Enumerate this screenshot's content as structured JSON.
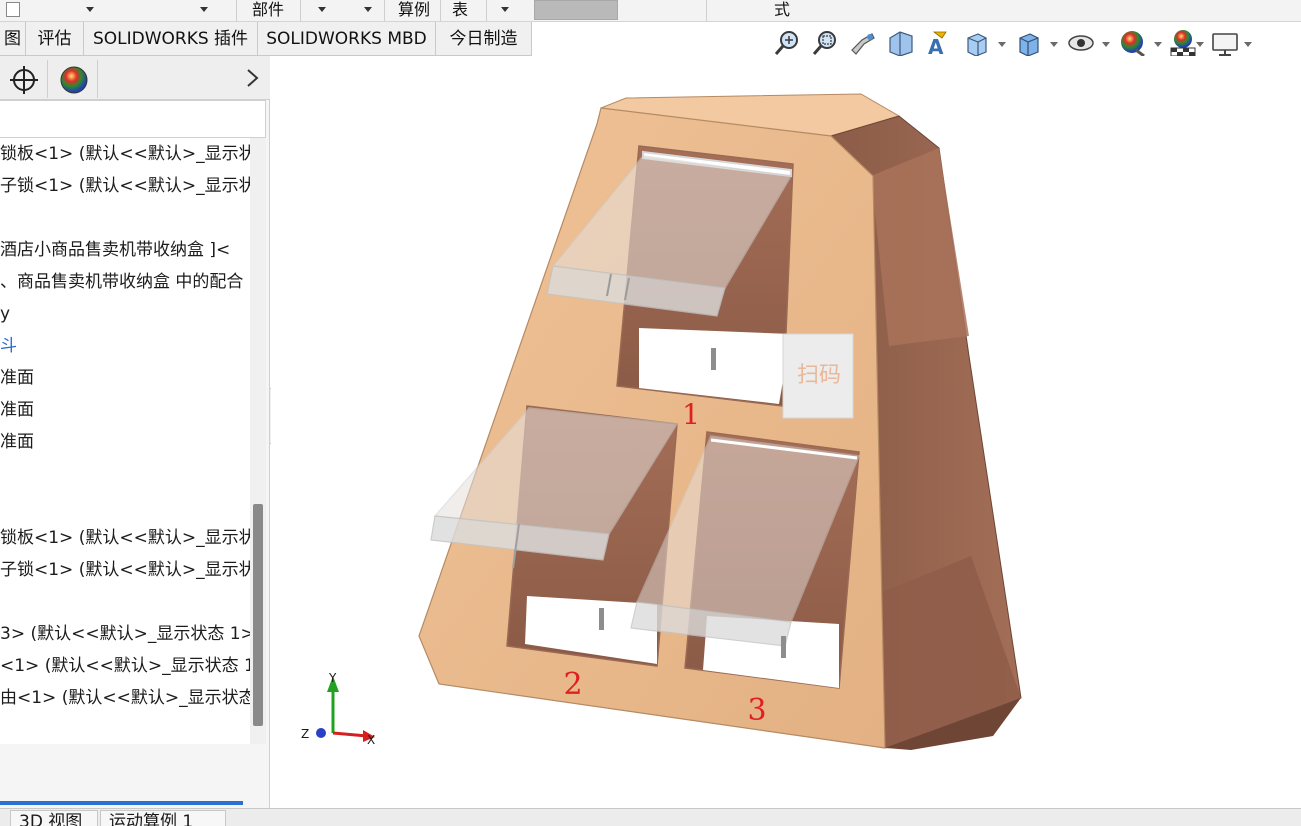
{
  "ribbon_top": {
    "component_label": "部件",
    "example_label": "算例",
    "table_label": "表",
    "style_label": "式"
  },
  "tabs": [
    {
      "label": "图"
    },
    {
      "label": "评估"
    },
    {
      "label": "SOLIDWORKS 插件"
    },
    {
      "label": "SOLIDWORKS MBD"
    },
    {
      "label": "今日制造"
    }
  ],
  "tree": {
    "items": [
      {
        "label": "锁板<1> (默认<<默认>_显示状"
      },
      {
        "label": "子锁<1> (默认<<默认>_显示状"
      },
      {
        "label": ""
      },
      {
        "label": "酒店小商品售卖机带收纳盒 ]<"
      },
      {
        "label": "、商品售卖机带收纳盒 中的配合"
      },
      {
        "label": "y"
      },
      {
        "label": "斗"
      },
      {
        "label": "准面"
      },
      {
        "label": "准面"
      },
      {
        "label": "准面"
      },
      {
        "label": ""
      },
      {
        "label": "锁板<1> (默认<<默认>_显示状"
      },
      {
        "label": "子锁<1> (默认<<默认>_显示状"
      },
      {
        "label": ""
      },
      {
        "label": "3> (默认<<默认>_显示状态 1>"
      },
      {
        "label": "<1> (默认<<默认>_显示状态 1"
      },
      {
        "label": "由<1> (默认<<默认>_显示状态"
      }
    ]
  },
  "model": {
    "scan_label": "扫码",
    "slot_labels": [
      "1",
      "2",
      "3"
    ]
  },
  "triad": {
    "x": "X",
    "y": "Y",
    "z": "Z"
  },
  "bottom_tabs": [
    {
      "label": "3D 视图"
    },
    {
      "label": "运动算例 1"
    }
  ],
  "colors": {
    "body_front": "#e8b98c",
    "body_side": "#96644f",
    "slot_label": "#e02020",
    "accent_blue": "#2b6fd1"
  }
}
